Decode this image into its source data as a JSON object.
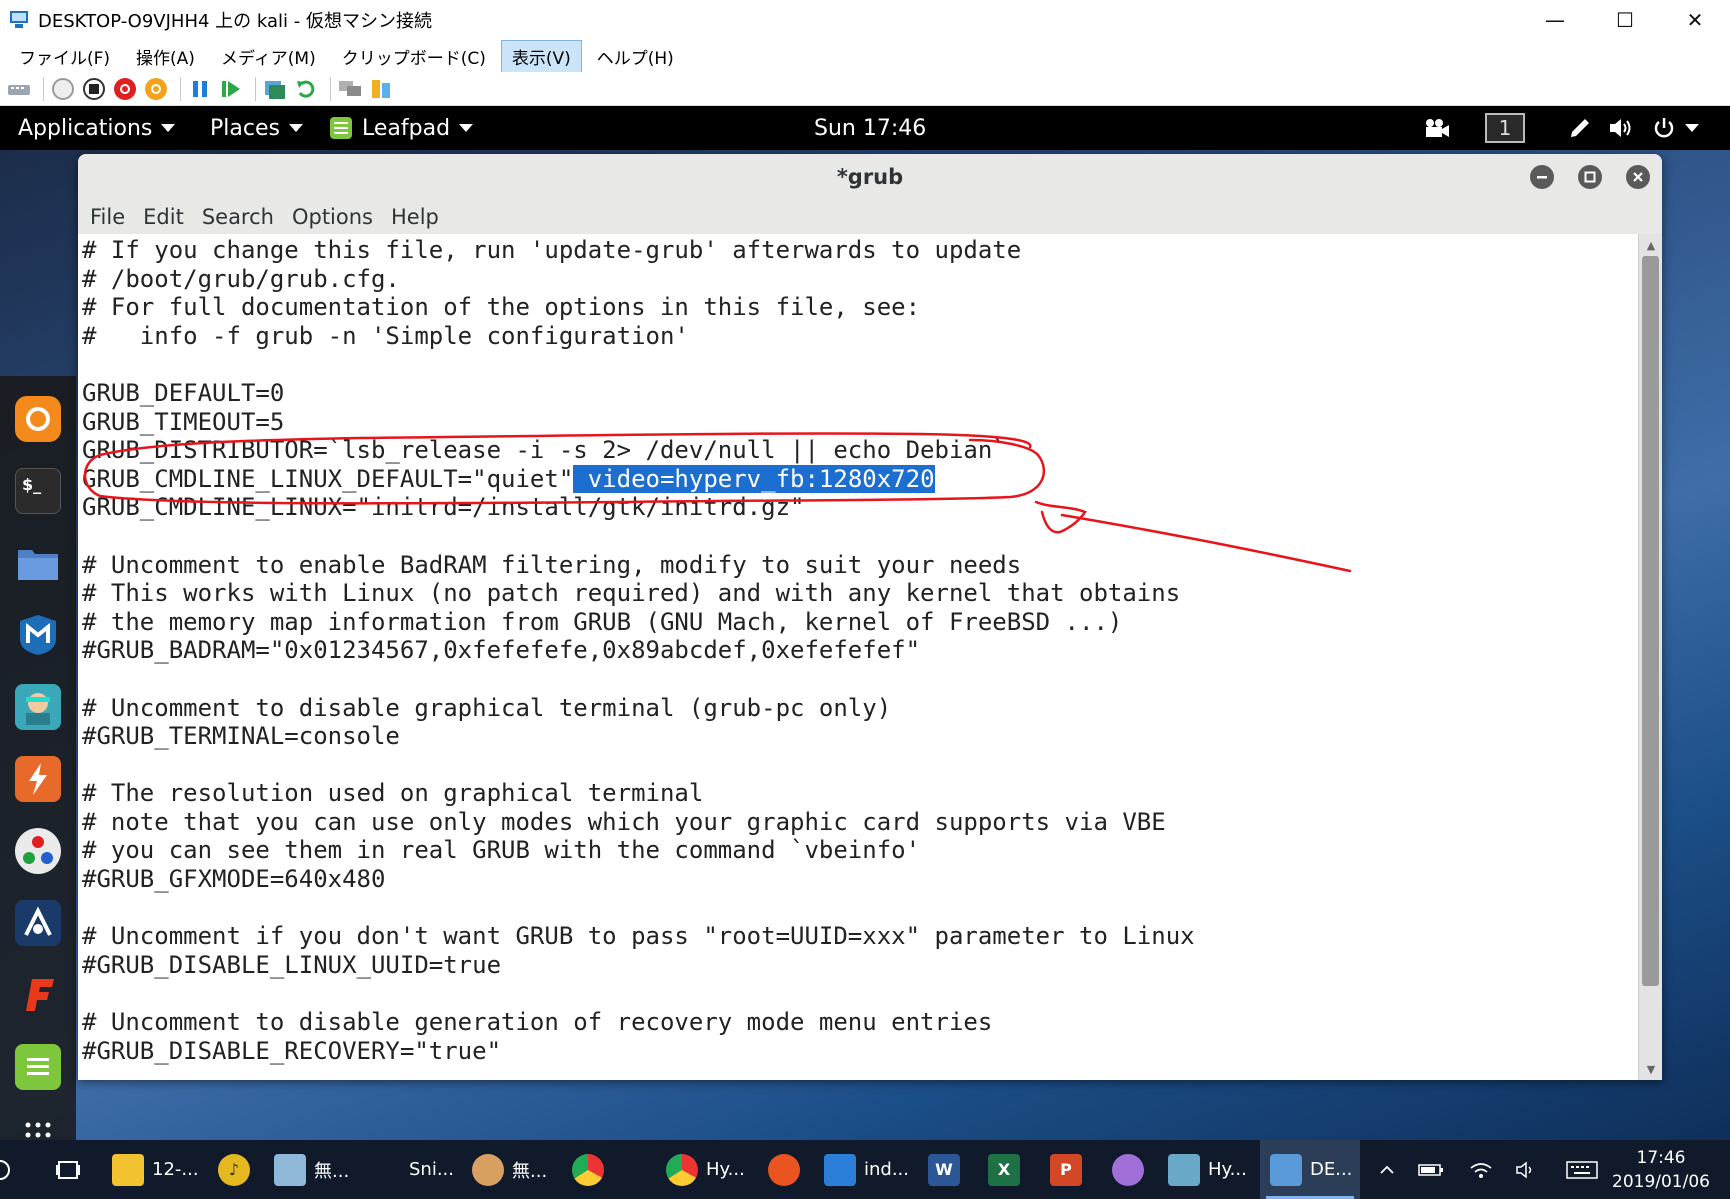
{
  "host_window": {
    "title": "DESKTOP-O9VJHH4 上の kali - 仮想マシン接続",
    "minimize_glyph": "—",
    "maximize_glyph": "☐",
    "close_glyph": "✕"
  },
  "host_menu": [
    {
      "label": "ファイル(F)"
    },
    {
      "label": "操作(A)"
    },
    {
      "label": "メディア(M)"
    },
    {
      "label": "クリップボード(C)"
    },
    {
      "label": "表示(V)"
    },
    {
      "label": "ヘルプ(H)"
    }
  ],
  "guest_panel": {
    "applications": "Applications",
    "places": "Places",
    "app_name": "Leafpad",
    "clock": "Sun 17:46",
    "workspace": "1"
  },
  "leafpad": {
    "title": "*grub",
    "menu": [
      {
        "label": "File"
      },
      {
        "label": "Edit"
      },
      {
        "label": "Search"
      },
      {
        "label": "Options"
      },
      {
        "label": "Help"
      }
    ],
    "lines": [
      "# If you change this file, run 'update-grub' afterwards to update",
      "# /boot/grub/grub.cfg.",
      "# For full documentation of the options in this file, see:",
      "#   info -f grub -n 'Simple configuration'",
      "",
      "GRUB_DEFAULT=0",
      "GRUB_TIMEOUT=5",
      "GRUB_DISTRIBUTOR=`lsb_release -i -s 2> /dev/null || echo Debian`",
      "GRUB_CMDLINE_LINUX_DEFAULT=\"quiet\"",
      "GRUB_CMDLINE_LINUX=\"initrd=/install/gtk/initrd.gz\"",
      "",
      "# Uncomment to enable BadRAM filtering, modify to suit your needs",
      "# This works with Linux (no patch required) and with any kernel that obtains",
      "# the memory map information from GRUB (GNU Mach, kernel of FreeBSD ...)",
      "#GRUB_BADRAM=\"0x01234567,0xfefefefe,0x89abcdef,0xefefefef\"",
      "",
      "# Uncomment to disable graphical terminal (grub-pc only)",
      "#GRUB_TERMINAL=console",
      "",
      "# The resolution used on graphical terminal",
      "# note that you can use only modes which your graphic card supports via VBE",
      "# you can see them in real GRUB with the command `vbeinfo'",
      "#GRUB_GFXMODE=640x480",
      "",
      "# Uncomment if you don't want GRUB to pass \"root=UUID=xxx\" parameter to Linux",
      "#GRUB_DISABLE_LINUX_UUID=true",
      "",
      "# Uncomment to disable generation of recovery mode menu entries",
      "#GRUB_DISABLE_RECOVERY=\"true\""
    ],
    "selected_text": " video=hyperv_fb:1280x720"
  },
  "taskbar": {
    "items": [
      {
        "label": "12-..."
      },
      {
        "label": ""
      },
      {
        "label": "無..."
      },
      {
        "label": "Sni..."
      },
      {
        "label": "無..."
      },
      {
        "label": ""
      },
      {
        "label": "Hy..."
      },
      {
        "label": ""
      },
      {
        "label": "ind..."
      },
      {
        "label": ""
      },
      {
        "label": ""
      },
      {
        "label": ""
      },
      {
        "label": ""
      },
      {
        "label": "Hy..."
      },
      {
        "label": "DE..."
      }
    ],
    "time": "17:46",
    "date": "2019/01/06"
  },
  "colors": {
    "selection": "#1c6fd0",
    "annotation": "#e8141c",
    "taskbar": "#101a2b"
  }
}
